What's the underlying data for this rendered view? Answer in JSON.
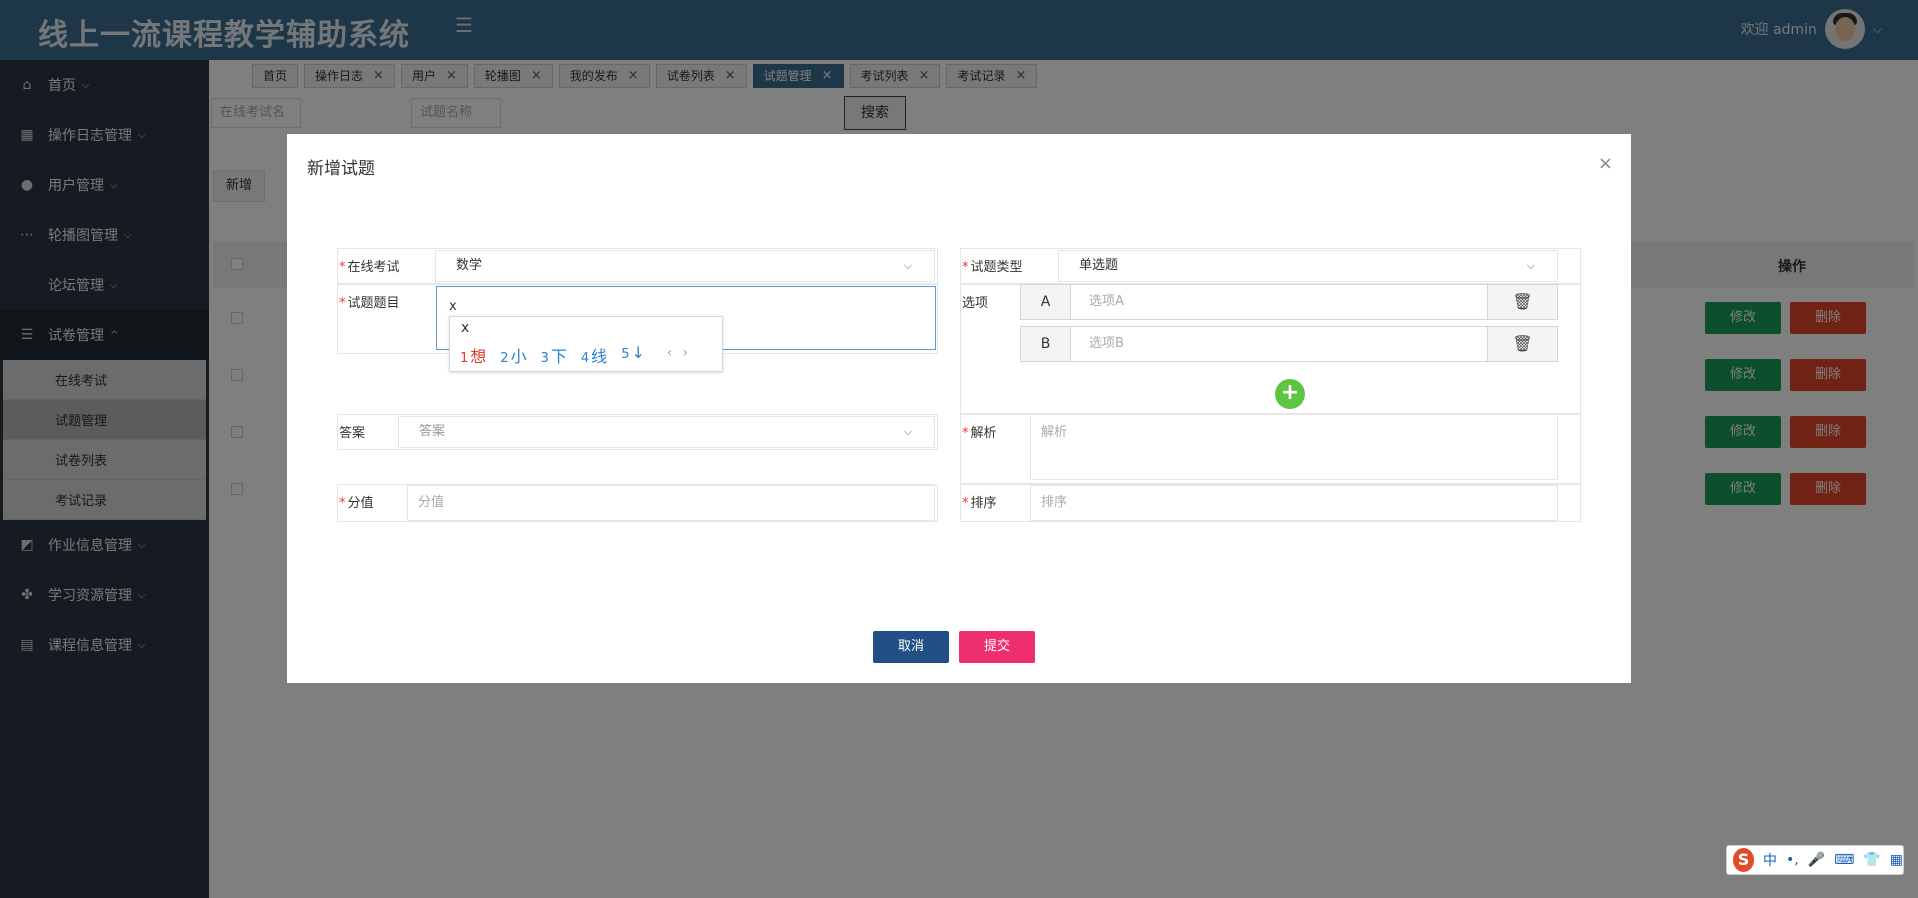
{
  "header": {
    "app_title": "线上一流课程教学辅助系统",
    "welcome_text": "欢迎 admin"
  },
  "sidebar": {
    "items": [
      {
        "label": "首页",
        "icon": "home-icon"
      },
      {
        "label": "操作日志管理",
        "icon": "grid-icon"
      },
      {
        "label": "用户管理",
        "icon": "user-icon"
      },
      {
        "label": "轮播图管理",
        "icon": "dots-icon"
      },
      {
        "label": "论坛管理",
        "icon": "none"
      },
      {
        "label": "试卷管理",
        "icon": "list-icon"
      },
      {
        "label": "作业信息管理",
        "icon": "chart-icon"
      },
      {
        "label": "学习资源管理",
        "icon": "apps-icon"
      },
      {
        "label": "课程信息管理",
        "icon": "table-icon"
      }
    ],
    "submenu": [
      "在线考试",
      "试题管理",
      "试卷列表",
      "考试记录"
    ]
  },
  "tabs": [
    "首页",
    "操作日志",
    "用户",
    "轮播图",
    "我的发布",
    "试卷列表",
    "试题管理",
    "考试列表",
    "考试记录"
  ],
  "search": {
    "exam_placeholder": "在线考试名",
    "name_placeholder": "试题名称",
    "search_label": "搜索",
    "add_label": "新增"
  },
  "table": {
    "op_header": "操作",
    "edit_label": "修改",
    "delete_label": "删除"
  },
  "modal": {
    "title": "新增试题",
    "close": "×",
    "exam_label": "在线考试",
    "exam_value": "数学",
    "type_label": "试题类型",
    "type_value": "单选题",
    "question_label": "试题题目",
    "question_value": "x",
    "options_label": "选项",
    "option_a_key": "A",
    "option_a_placeholder": "选项A",
    "option_b_key": "B",
    "option_b_placeholder": "选项B",
    "answer_label": "答案",
    "answer_placeholder": "答案",
    "analysis_label": "解析",
    "analysis_placeholder": "解析",
    "score_label": "分值",
    "score_placeholder": "分值",
    "sort_label": "排序",
    "sort_placeholder": "排序",
    "cancel_label": "取消",
    "submit_label": "提交"
  },
  "ime": {
    "typed": "x",
    "candidates": [
      {
        "num": "1",
        "word": "想"
      },
      {
        "num": "2",
        "word": "小"
      },
      {
        "num": "3",
        "word": "下"
      },
      {
        "num": "4",
        "word": "线"
      },
      {
        "num": "5",
        "word": "↓"
      }
    ],
    "toolbar_mode": "中"
  },
  "colors": {
    "header": "#3b6f93",
    "sidebar": "#2b3642",
    "edit": "#1a9d5b",
    "delete": "#e0452b",
    "cancel": "#214f86",
    "submit": "#ee2f6e",
    "add_option": "#5ec443"
  }
}
